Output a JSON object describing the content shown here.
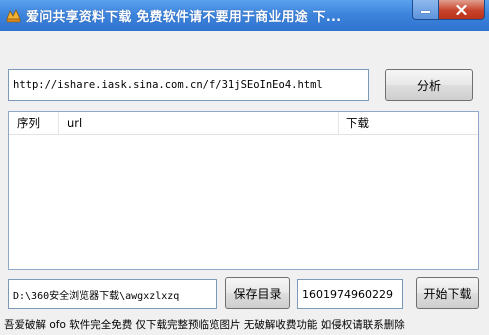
{
  "window": {
    "title": "爱问共享资料下载 免费软件请不要用于商业用途 下...",
    "icon": "app-logo-icon",
    "minimize_icon": "minimize-icon",
    "close_icon": "close-icon"
  },
  "url_input": {
    "value": "http://ishare.iask.sina.com.cn/f/31jSEoInEo4.html"
  },
  "analyze_button": {
    "label": "分析"
  },
  "list": {
    "columns": [
      "序列",
      "url",
      "下载"
    ],
    "rows": []
  },
  "save_path_input": {
    "value": "D:\\360安全浏览器下载\\awgxzlxzq"
  },
  "save_dir_button": {
    "label": "保存目录"
  },
  "number_input": {
    "value": "1601974960229"
  },
  "start_button": {
    "label": "开始下载"
  },
  "status_bar": {
    "text": "吾爱破解 ofo 软件完全免费 仅下载完整预临览图片 无破解收费功能 如侵权请联系删除"
  },
  "colors": {
    "titlebar": "#3d84dc",
    "close_button": "#c8432c",
    "window_bg": "#f0f0f0"
  }
}
